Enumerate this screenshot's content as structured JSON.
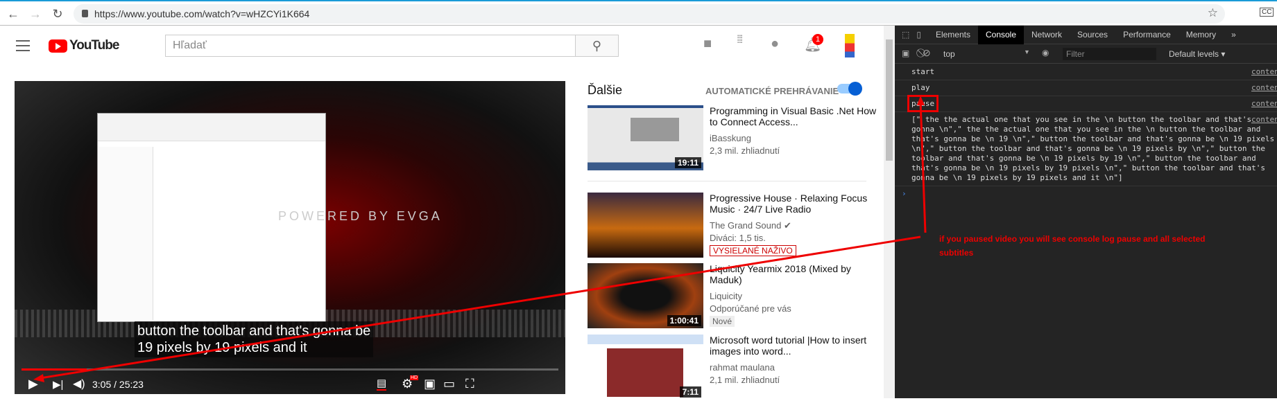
{
  "browser": {
    "url": "https://www.youtube.com/watch?v=wHZCYi1K664"
  },
  "youtube": {
    "logo": "YouTube",
    "search_placeholder": "Hľadať",
    "notification_count": "1",
    "video": {
      "subtitle_lines": [
        "button the toolbar and that's gonna be",
        "19 pixels by 19 pixels and it"
      ],
      "time": "3:05 / 25:23",
      "progress_fraction": 0.122,
      "overlay_brand": "POWERED BY EVGA"
    },
    "next": {
      "header": "Ďalšie",
      "autoplay_label": "AUTOMATICKÉ PREHRÁVANIE",
      "autoplay_on": true,
      "videos": [
        {
          "title": "Programming in Visual Basic .Net How to Connect Access...",
          "channel": "iBasskung",
          "meta": "2,3 mil. zhliadnutí",
          "duration": "19:11"
        },
        {
          "title": "Progressive House · Relaxing Focus Music · 24/7 Live Radio",
          "channel": "The Grand Sound",
          "meta": "Diváci: 1,5 tis.",
          "badge": "VYSIELANÉ NAŽIVO"
        },
        {
          "title": "Liquicity Yearmix 2018 (Mixed by Maduk)",
          "channel": "Liquicity",
          "meta": "Odporúčané pre vás",
          "badge": "Nové",
          "duration": "1:00:41"
        },
        {
          "title": "Microsoft word tutorial |How to insert images into word...",
          "channel": "rahmat maulana",
          "meta": "2,1 mil. zhliadnutí",
          "duration": "7:11"
        }
      ]
    }
  },
  "devtools": {
    "tabs": [
      "Elements",
      "Console",
      "Network",
      "Sources",
      "Performance",
      "Memory",
      "»"
    ],
    "context": "top",
    "filter_placeholder": "Filter",
    "levels": "Default levels ▾",
    "source_link": "conten",
    "logs": [
      "start",
      "play",
      "pause"
    ],
    "array_log": "[\" the the actual one that you see in the \\n button the toolbar and that's gonna \\n\",\" the the actual one that you see in the \\n button the toolbar and that's gonna be \\n 19 \\n\",\" button the toolbar and that's gonna be \\n 19 pixels \\n\",\" button the toolbar and that's gonna be \\n 19 pixels by \\n\",\" button the toolbar and that's gonna be \\n 19 pixels by 19 \\n\",\" button the toolbar and that's gonna be \\n 19 pixels by 19 pixels \\n\",\" button the toolbar and that's gonna be \\n 19 pixels by 19 pixels and it \\n\"]",
    "prompt": "›"
  },
  "annotation": {
    "text": "if you paused video you will see console log pause and all selected subtitles",
    "color": "#ee0000"
  }
}
